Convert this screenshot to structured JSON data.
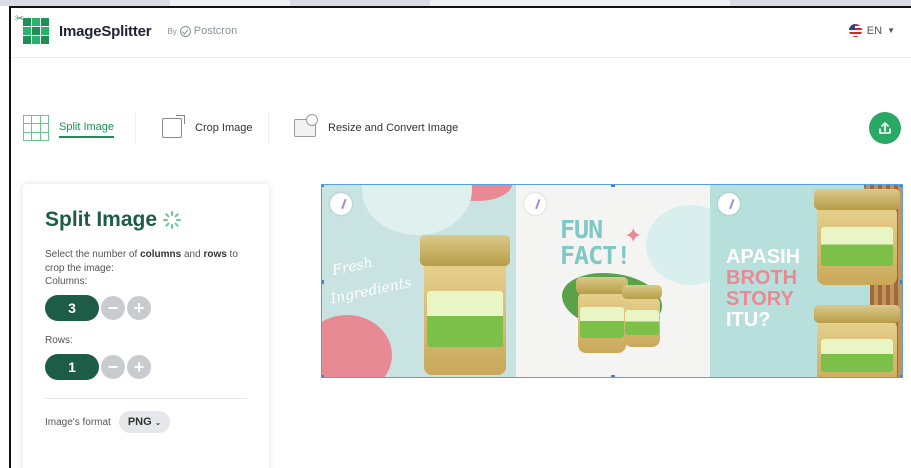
{
  "header": {
    "brand": "ImageSplitter",
    "by": "By",
    "partner": "Postcron",
    "language": "EN"
  },
  "toolbar": {
    "tabs": [
      {
        "label": "Split Image",
        "icon": "split-grid-icon",
        "active": true
      },
      {
        "label": "Crop Image",
        "icon": "crop-icon",
        "active": false
      },
      {
        "label": "Resize and Convert Image",
        "icon": "resize-convert-icon",
        "active": false
      }
    ],
    "upload_icon": "upload-icon"
  },
  "panel": {
    "title": "Split Image",
    "desc_prefix": "Select the number of ",
    "desc_columns": "columns",
    "desc_and": " and ",
    "desc_rows": "rows",
    "desc_suffix": " to crop the image:",
    "columns_label": "Columns:",
    "columns_value": "3",
    "rows_label": "Rows:",
    "rows_value": "1",
    "minus": "−",
    "plus": "+",
    "format_label": "Image's format",
    "format_value": "PNG"
  },
  "preview": {
    "tile1_text_1": "Fresh",
    "tile1_text_2": "Ingredients",
    "tile2_text_1": "FUN",
    "tile2_text_2": "FACT!",
    "tile3_text_1": "APASIH",
    "tile3_text_2": "BROTH",
    "tile3_text_3": "STORY",
    "tile3_text_4": "ITU?"
  },
  "colors": {
    "accent": "#1d5c47",
    "accent_light": "#2aa866",
    "selection": "#5aa0e0"
  }
}
